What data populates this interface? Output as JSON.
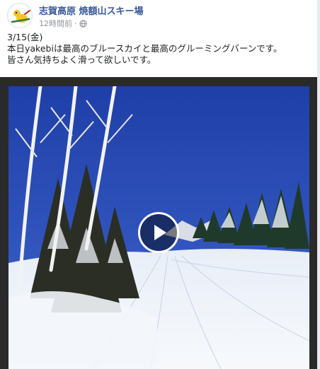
{
  "post": {
    "page_name": "志賀高原 焼額山スキー場",
    "timestamp": "12時間前",
    "privacy_separator": "·",
    "privacy_icon": "globe-icon",
    "caption_lines": [
      "3/15(金)",
      "本日yakebiは最高のブルースカイと最高のグルーミングバーンです。",
      "皆さん気持ちよく滑って欲しいです。"
    ]
  },
  "video": {
    "thumbnail": "snowy ski slope under blue sky",
    "play_icon": "play-icon"
  },
  "colors": {
    "link": "#385898",
    "meta": "#90949c",
    "sky": "#2a4db8"
  }
}
